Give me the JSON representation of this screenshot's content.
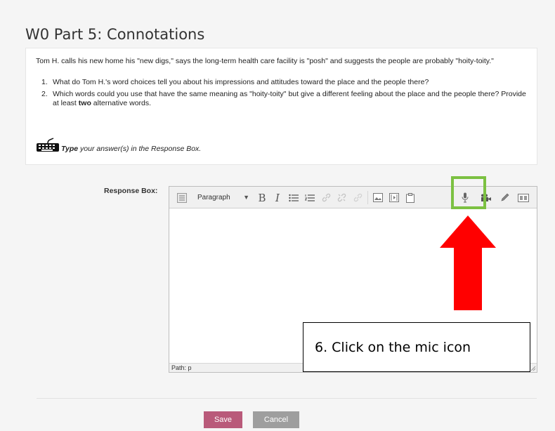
{
  "page": {
    "title": "W0 Part 5: Connotations"
  },
  "prompt": {
    "intro": "Tom H. calls his new home his \"new digs,\" says the long-term health care facility is \"posh\" and suggests the people are probably \"hoity-toity.\"",
    "questions": [
      {
        "number": "1.",
        "text": "What do Tom H.'s word choices tell you about his impressions and attitudes toward the place and the people there?"
      },
      {
        "number": "2.",
        "text_before": "Which words could you use that have the same meaning as \"hoity-toity\" but give a different feeling about the place and the people there?  Provide at least ",
        "text_bold": "two",
        "text_after": " alternative words."
      }
    ],
    "instruction_bold": "Type",
    "instruction_rest": " your answer(s) in the Response Box.",
    "icon": "keyboard-icon"
  },
  "response": {
    "label": "Response Box:",
    "format_select": "Paragraph",
    "toolbar_icons": [
      "toolbar-toggle-icon",
      "format-dropdown",
      "bold-icon",
      "italic-icon",
      "bullet-list-icon",
      "numbered-list-icon",
      "link-icon",
      "unlink-icon",
      "anchor-icon",
      "image-icon",
      "media-icon",
      "paste-icon",
      "mic-icon",
      "video-camera-icon",
      "pencil-icon",
      "embed-icon"
    ],
    "bold_glyph": "B",
    "italic_glyph": "I",
    "path": "Path: p"
  },
  "annotation": {
    "callout": "6. Click on the mic icon",
    "highlight_color": "#7cc142",
    "arrow_color": "#ff0000"
  },
  "buttons": {
    "save": "Save",
    "cancel": "Cancel"
  },
  "colors": {
    "save": "#b95a7a",
    "cancel": "#9e9e9e"
  }
}
